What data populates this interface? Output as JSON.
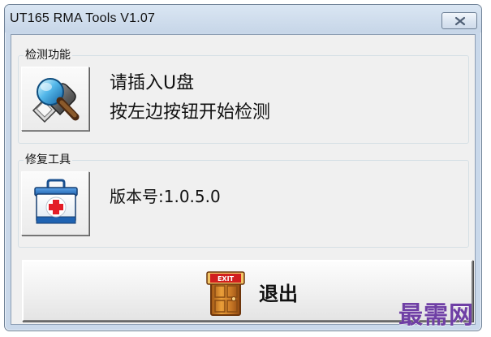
{
  "window": {
    "title": "UT165 RMA Tools  V1.07",
    "close_icon": "close-icon"
  },
  "detect_group": {
    "title": "检测功能",
    "button_icon": "usb-search-icon",
    "line1": "请插入U盘",
    "line2": "按左边按钮开始检测"
  },
  "repair_group": {
    "title": "修复工具",
    "button_icon": "medical-kit-icon",
    "version_text": "版本号:1.0.5.0"
  },
  "exit_button": {
    "icon": "exit-door-icon",
    "icon_text": "EXIT",
    "label": "退出"
  },
  "watermark": {
    "text": "最需网"
  },
  "colors": {
    "title_bar": "#d3e0ef",
    "window_border": "#6f8196",
    "client_bg": "#f0f0f0",
    "watermark": "#6f3fa5",
    "door": "#d58b2e",
    "exit_sign": "#d11f1f",
    "medical_cross": "#e31d27",
    "medical_kit": "#2368b7"
  }
}
